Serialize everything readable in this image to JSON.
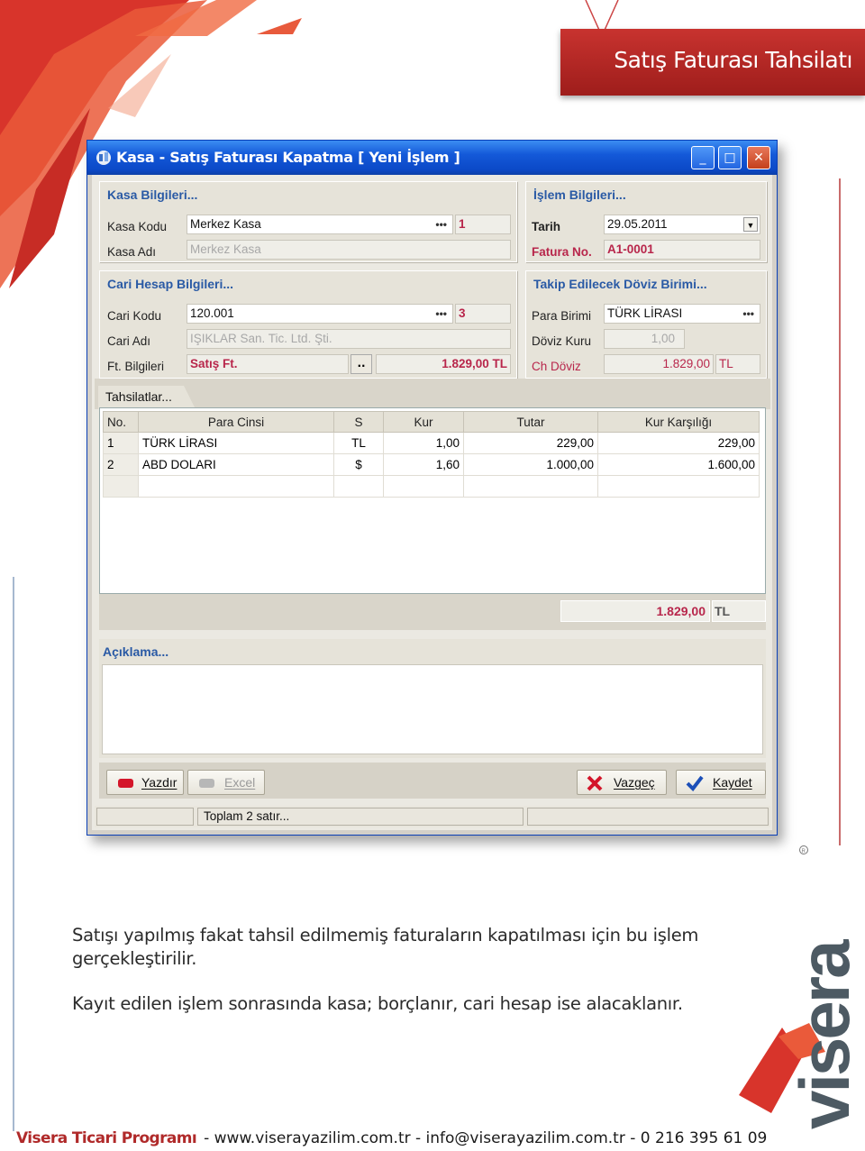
{
  "page": {
    "header_title": "Satış Faturası Tahsilatı",
    "description_line1": "Satışı yapılmış fakat tahsil edilmemiş faturaların kapatılması için bu işlem",
    "description_line2": "gerçekleştirilir.",
    "description_line3": "Kayıt edilen işlem sonrasında kasa; borçlanır, cari hesap ise alacaklanır.",
    "footer_brand": "Visera Ticari Programı",
    "footer_contact": "-  www.viserayazilim.com.tr -  info@viserayazilim.com.tr -   0 216 395 61 09",
    "logo_text": "visera",
    "accent_color": "#b02a2a"
  },
  "window": {
    "title": "Kasa - Satış Faturası Kapatma   [ Yeni İşlem ]",
    "minimize": "_",
    "maximize": "□",
    "close": "✕"
  },
  "kasa": {
    "title": "Kasa Bilgileri...",
    "kod_label": "Kasa Kodu",
    "kod_value": "Merkez Kasa",
    "kod_no": "1",
    "adi_label": "Kasa Adı",
    "adi_value": "Merkez Kasa"
  },
  "islem": {
    "title": "İşlem Bilgileri...",
    "tarih_label": "Tarih",
    "tarih_value": "29.05.2011",
    "fatura_label": "Fatura No.",
    "fatura_value": "A1-0001"
  },
  "cari": {
    "title": "Cari Hesap Bilgileri...",
    "kod_label": "Cari Kodu",
    "kod_value": "120.001",
    "kod_no": "3",
    "adi_label": "Cari Adı",
    "adi_value": "IŞIKLAR San. Tic. Ltd. Şti.",
    "ft_label": "Ft. Bilgileri",
    "ft_value": "Satış Ft.",
    "ft_button": "..",
    "ft_amount": "1.829,00 TL"
  },
  "doviz": {
    "title": "Takip Edilecek Döviz Birimi...",
    "para_label": "Para Birimi",
    "para_value": "TÜRK LİRASI",
    "kur_label": "Döviz Kuru",
    "kur_value": "1,00",
    "ch_label": "Ch Döviz",
    "ch_value": "1.829,00",
    "ch_cur": "TL"
  },
  "tab": {
    "label": "Tahsilatlar..."
  },
  "table": {
    "columns": [
      "No.",
      "Para Cinsi",
      "S",
      "Kur",
      "Tutar",
      "Kur Karşılığı"
    ],
    "rows": [
      [
        "1",
        "TÜRK LİRASI",
        "TL",
        "1,00",
        "229,00",
        "229,00"
      ],
      [
        "2",
        "ABD DOLARI",
        "$",
        "1,60",
        "1.000,00",
        "1.600,00"
      ]
    ],
    "total": "1.829,00",
    "total_cur": "TL"
  },
  "aciklama": {
    "title": "Açıklama..."
  },
  "buttons": {
    "yazdir": "Yazdır",
    "excel": "Excel",
    "vazgec": "Vazgeç",
    "kaydet": "Kaydet"
  },
  "status": {
    "rows_text": "Toplam 2 satır..."
  }
}
